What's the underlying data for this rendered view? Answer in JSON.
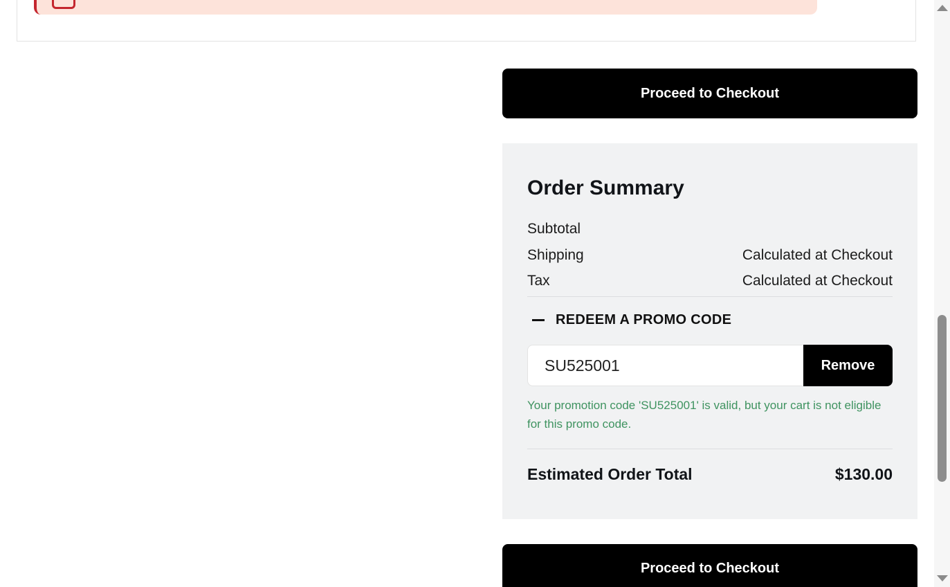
{
  "checkout": {
    "top_button_label": "Proceed to Checkout",
    "bottom_button_label": "Proceed to Checkout"
  },
  "order_summary": {
    "title": "Order Summary",
    "rows": [
      {
        "label": "Subtotal",
        "value": ""
      },
      {
        "label": "Shipping",
        "value": "Calculated at Checkout"
      },
      {
        "label": "Tax",
        "value": "Calculated at Checkout"
      }
    ],
    "promo": {
      "toggle_label": "REDEEM A PROMO CODE",
      "code_value": "SU525001",
      "remove_label": "Remove",
      "message": "Your promotion code 'SU525001' is valid, but your cart is not eligible for this promo code."
    },
    "total": {
      "label": "Estimated Order Total",
      "value": "$130.00"
    }
  },
  "colors": {
    "alert_background": "#fde3da",
    "alert_accent": "#c4262e",
    "summary_background": "#f1f2f3",
    "promo_message": "#3f9360",
    "button_background": "#000000"
  }
}
